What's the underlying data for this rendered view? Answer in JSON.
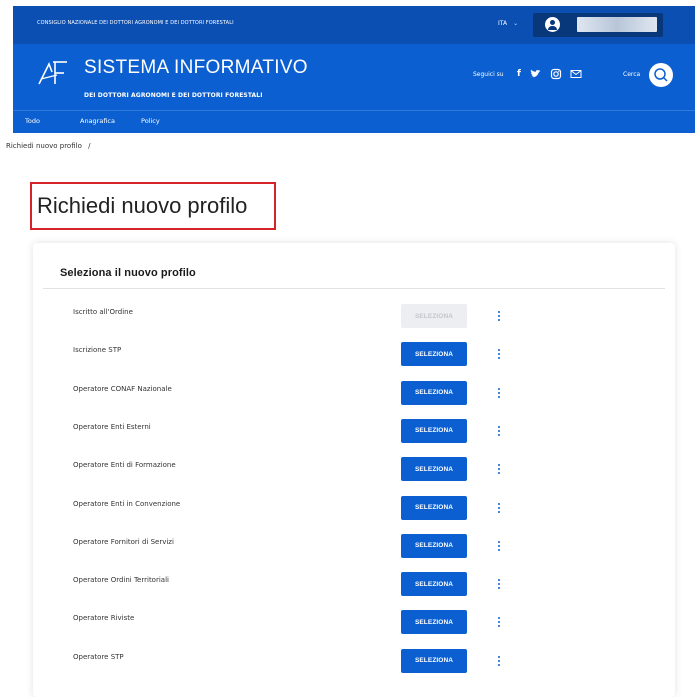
{
  "topbar": {
    "org_name": "CONSIGLIO NAZIONALE DEI DOTTORI AGRONOMI E DEI DOTTORI FORESTALI",
    "language": "ITA"
  },
  "header": {
    "title": "SISTEMA INFORMATIVO",
    "subtitle": "DEI DOTTORI AGRONOMI E DEI DOTTORI FORESTALI",
    "follow_label": "Seguici su",
    "social_icons": [
      "facebook-icon",
      "twitter-icon",
      "instagram-icon",
      "mail-icon"
    ],
    "search_label": "Cerca"
  },
  "nav": {
    "items": [
      "Todo",
      "Anagrafica",
      "Policy"
    ]
  },
  "breadcrumb": {
    "current": "Richiedi nuovo profilo",
    "separator": "/"
  },
  "page": {
    "title": "Richiedi nuovo profilo"
  },
  "card": {
    "title": "Seleziona il nuovo profilo",
    "button_label": "SELEZIONA",
    "rows": [
      {
        "label": "Iscritto all'Ordine",
        "enabled": false
      },
      {
        "label": "Iscrizione STP",
        "enabled": true
      },
      {
        "label": "Operatore CONAF Nazionale",
        "enabled": true
      },
      {
        "label": "Operatore Enti Esterni",
        "enabled": true
      },
      {
        "label": "Operatore Enti di Formazione",
        "enabled": true
      },
      {
        "label": "Operatore Enti in Convenzione",
        "enabled": true
      },
      {
        "label": "Operatore Fornitori di Servizi",
        "enabled": true
      },
      {
        "label": "Operatore Ordini Territoriali",
        "enabled": true
      },
      {
        "label": "Operatore Riviste",
        "enabled": true
      },
      {
        "label": "Operatore STP",
        "enabled": true
      }
    ]
  },
  "colors": {
    "primary": "#0b5fd0",
    "topbar": "#0b4fb3",
    "highlight_border": "#d6232a"
  }
}
